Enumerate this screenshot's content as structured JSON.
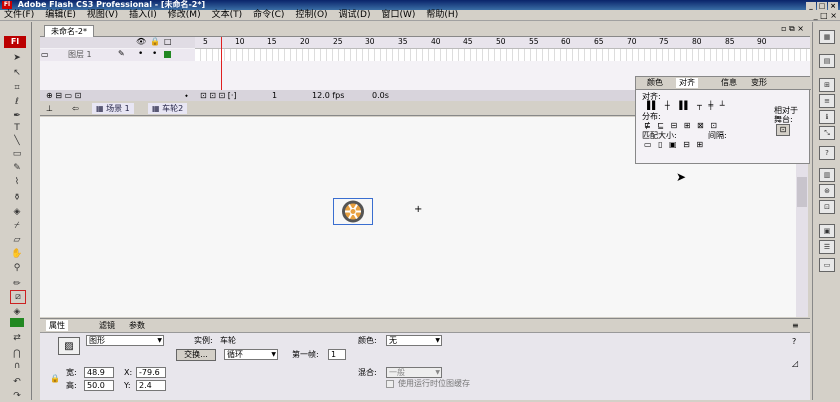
{
  "window": {
    "title": "Adobe Flash CS3 Professional - [未命名-2*]"
  },
  "menu": [
    "文件(F)",
    "编辑(E)",
    "视图(V)",
    "插入(I)",
    "修改(M)",
    "文本(T)",
    "命令(C)",
    "控制(O)",
    "调试(D)",
    "窗口(W)",
    "帮助(H)"
  ],
  "toolbar": {
    "logo": "Fl"
  },
  "document": {
    "tab": "未命名-2*"
  },
  "timeline": {
    "frame_numbers": [
      "5",
      "10",
      "15",
      "20",
      "25",
      "30",
      "35",
      "40",
      "45",
      "50",
      "55",
      "60",
      "65",
      "70",
      "75",
      "80",
      "85",
      "90"
    ],
    "layer_name": "图层 1",
    "frame": "1",
    "fps": "12.0 fps",
    "time": "0.0s"
  },
  "editbar": {
    "scene": "场景 1",
    "symbol": "车轮2"
  },
  "align_panel": {
    "tabs": [
      "颜色",
      "对齐",
      "信息",
      "变形"
    ],
    "align_label": "对齐:",
    "distribute_label": "分布:",
    "match_size_label": "匹配大小:",
    "spacing_label": "间隔:",
    "relative_label": "相对于",
    "stage_label": "舞台:"
  },
  "properties": {
    "tabs": [
      "属性",
      "滤镜",
      "参数"
    ],
    "type": "图形",
    "instance_label": "实例:",
    "instance_name": "车轮",
    "swap_button": "交换...",
    "loop": "循环",
    "first_frame_label": "第一帧:",
    "first_frame": "1",
    "color_label": "颜色:",
    "color_value": "无",
    "width_label": "宽:",
    "width": "48.9",
    "height_label": "高:",
    "height": "50.0",
    "x_label": "X:",
    "x": "-79.6",
    "y_label": "Y:",
    "y": "2.4",
    "blend_label": "混合:",
    "blend": "一般",
    "cache_label": "使用运行时位图缓存"
  },
  "colors": {
    "stroke": "#cc2222",
    "fill": "#228822",
    "playhead": "#e02020"
  }
}
